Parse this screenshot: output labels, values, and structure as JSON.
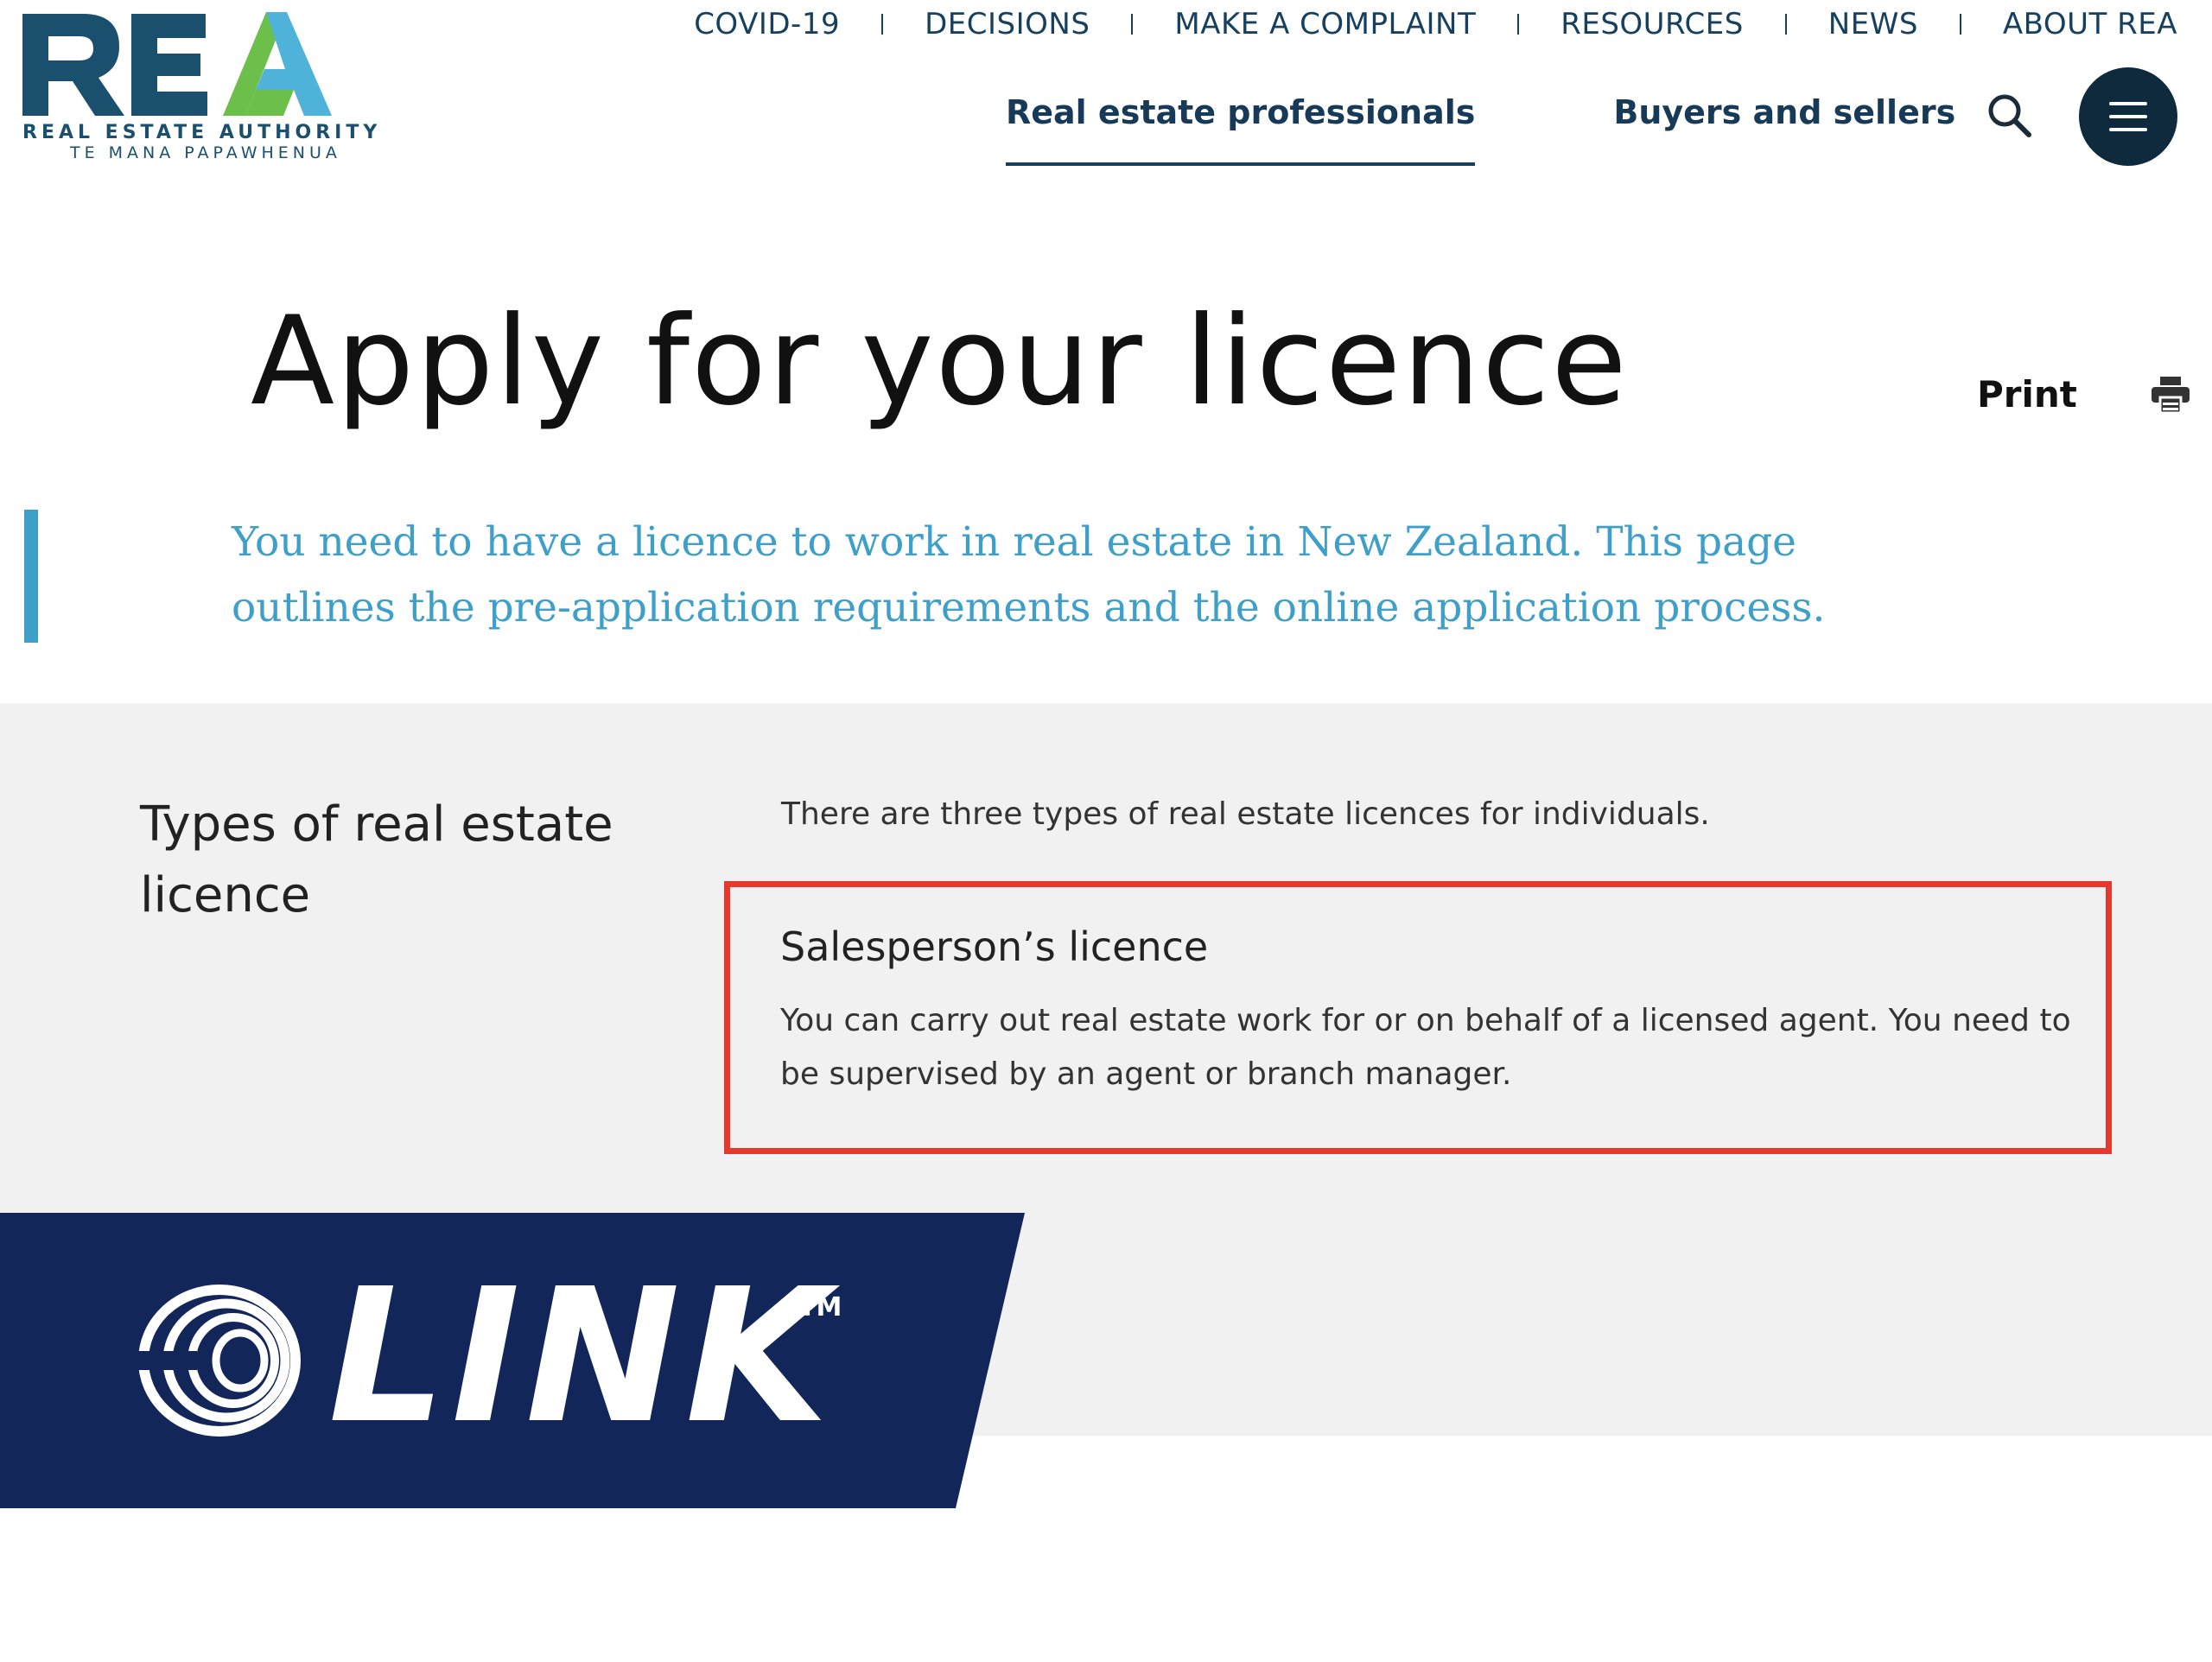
{
  "header": {
    "logo_letters": "REA",
    "logo_line1": "REAL ESTATE AUTHORITY",
    "logo_line2": "TE MANA PAPAWHENUA",
    "utility_links": [
      "COVID-19",
      "DECISIONS",
      "MAKE A COMPLAINT",
      "RESOURCES",
      "NEWS",
      "ABOUT REA"
    ],
    "main_nav": [
      {
        "label": "Real estate professionals",
        "active": true
      },
      {
        "label": "Buyers and sellers",
        "active": false
      }
    ],
    "search_icon": "search-icon",
    "menu_icon": "hamburger-menu-icon"
  },
  "page": {
    "title": "Apply for your licence",
    "print_label": "Print",
    "print_icon": "printer-icon",
    "intro": "You need to have a licence to work in real estate in New Zealand. This page outlines the pre-application requirements and the online application process."
  },
  "types_section": {
    "heading": "Types of real estate licence",
    "intro": "There are three types of real estate licences for individuals.",
    "licence": {
      "title": "Salesperson’s licence",
      "description": "You can carry out real estate work for or on behalf of a licensed agent. You need to be supervised by an agent or branch manager."
    }
  },
  "banner": {
    "brand": "LINK",
    "trademark": "TM"
  },
  "colors": {
    "navy": "#17405f",
    "accent_blue": "#3e9fc9",
    "logo_green": "#6cbf4b",
    "logo_light_blue": "#4fb3d9",
    "highlight_red": "#e5392f",
    "banner_navy": "#12265a",
    "grey_bg": "#f1f1f1"
  }
}
